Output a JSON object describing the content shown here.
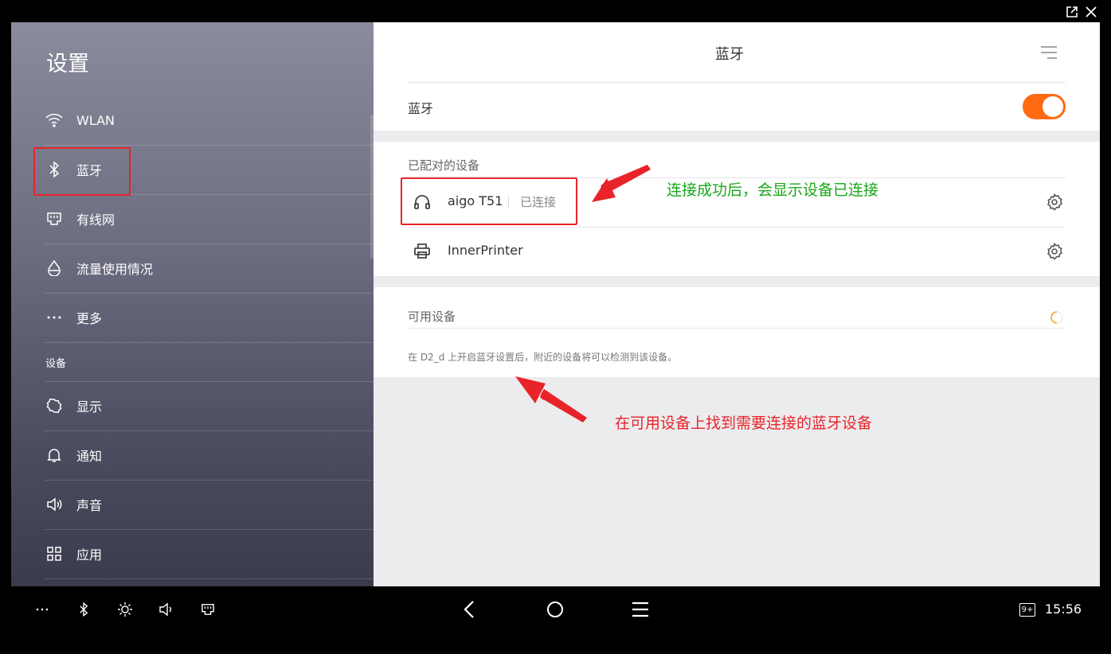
{
  "window": {
    "controls": [
      "popout-icon",
      "close-icon"
    ]
  },
  "sidebar": {
    "title": "设置",
    "items": [
      {
        "label": "WLAN",
        "icon": "wifi-icon"
      },
      {
        "label": "蓝牙",
        "icon": "bluetooth-icon"
      },
      {
        "label": "有线网",
        "icon": "ethernet-icon"
      },
      {
        "label": "流量使用情况",
        "icon": "data-usage-icon"
      },
      {
        "label": "更多",
        "icon": "more-dots-icon"
      }
    ],
    "section_devices": "设备",
    "device_items": [
      {
        "label": "显示",
        "icon": "display-icon"
      },
      {
        "label": "通知",
        "icon": "bell-icon"
      },
      {
        "label": "声音",
        "icon": "speaker-icon"
      },
      {
        "label": "应用",
        "icon": "apps-grid-icon"
      }
    ]
  },
  "main": {
    "title": "蓝牙",
    "bluetooth_row": {
      "label": "蓝牙",
      "enabled": true
    },
    "paired": {
      "label": "已配对的设备",
      "devices": [
        {
          "name": "aigo T51",
          "status": "已连接",
          "icon": "headphones-icon"
        },
        {
          "name": "InnerPrinter",
          "status": "",
          "icon": "printer-icon"
        }
      ]
    },
    "available": {
      "label": "可用设备",
      "hint": "在 D2_d 上开启蓝牙设置后，附近的设备将可以检测到该设备。"
    }
  },
  "annotations": {
    "green": "连接成功后，会显示设备已连接",
    "red": "在可用设备上找到需要连接的蓝牙设备"
  },
  "colors": {
    "accent": "#ff6a13",
    "annotation_red": "#e8242a",
    "annotation_green": "#1aa71a"
  },
  "navbar": {
    "badge": "9+",
    "time": "15:56"
  }
}
